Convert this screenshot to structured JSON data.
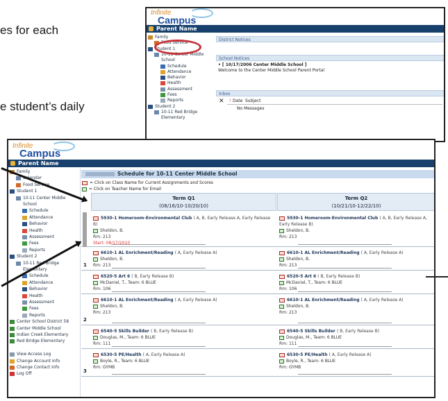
{
  "document": {
    "line1": "es for each",
    "line2": "e student’s daily"
  },
  "back": {
    "logo_top": "Infinite",
    "logo_bottom": "Campus",
    "bar_title": "Parent Name",
    "sidebar": [
      {
        "label": "Family",
        "icon": "family-icon"
      },
      {
        "label": "Food Service",
        "icon": "food-icon"
      },
      {
        "label": "Student 1",
        "icon": "student-icon"
      },
      {
        "label": "10-11 Center Middle",
        "icon": "calendar-icon"
      },
      {
        "label": "School",
        "icon": ""
      },
      {
        "label": "Schedule",
        "icon": "schedule-icon"
      },
      {
        "label": "Attendance",
        "icon": "attendance-icon"
      },
      {
        "label": "Behavior",
        "icon": "behavior-icon"
      },
      {
        "label": "Health",
        "icon": "health-icon"
      },
      {
        "label": "Assessment",
        "icon": "assessment-icon"
      },
      {
        "label": "Fees",
        "icon": "fees-icon"
      },
      {
        "label": "Reports",
        "icon": "reports-icon"
      },
      {
        "label": "Student 2",
        "icon": "student-icon"
      },
      {
        "label": "10-11 Red Bridge",
        "icon": "calendar-icon"
      },
      {
        "label": "Elementary",
        "icon": ""
      }
    ],
    "district_notices": "District Notices",
    "school_notices": "School Notices",
    "notice_line1": "• [ 10/17/2006 Center Middle School ]",
    "notice_line2": "Welcome to the Center Middle School Parent Portal",
    "inbox": "Inbox",
    "inbox_cols": [
      "Date",
      "Subject"
    ],
    "no_messages": "No Messages"
  },
  "front": {
    "logo_top": "Infinite",
    "logo_bottom": "Campus",
    "bar_title": "Parent Name",
    "sidebar": [
      {
        "label": "Family",
        "icon": "family-icon",
        "indent": 0
      },
      {
        "label": "Calendar",
        "icon": "calendar-icon",
        "indent": 1
      },
      {
        "label": "Food Service",
        "icon": "food-icon",
        "indent": 1
      },
      {
        "label": "Student 1",
        "icon": "student-icon",
        "indent": 0
      },
      {
        "label": "10-11 Center Middle",
        "icon": "calendar-icon",
        "indent": 1
      },
      {
        "label": "School",
        "icon": "",
        "indent": 1
      },
      {
        "label": "Schedule",
        "icon": "schedule-icon",
        "indent": 2
      },
      {
        "label": "Attendance",
        "icon": "attendance-icon",
        "indent": 2
      },
      {
        "label": "Behavior",
        "icon": "behavior-icon",
        "indent": 2
      },
      {
        "label": "Health",
        "icon": "health-icon",
        "indent": 2
      },
      {
        "label": "Assessment",
        "icon": "assessment-icon",
        "indent": 2
      },
      {
        "label": "Fees",
        "icon": "fees-icon",
        "indent": 2
      },
      {
        "label": "Reports",
        "icon": "reports-icon",
        "indent": 2
      },
      {
        "label": "Student 2",
        "icon": "student-icon",
        "indent": 0
      },
      {
        "label": "10-11 Red Bridge",
        "icon": "calendar-icon",
        "indent": 1
      },
      {
        "label": "Elementary",
        "icon": "",
        "indent": 1
      },
      {
        "label": "Schedule",
        "icon": "schedule-icon",
        "indent": 2
      },
      {
        "label": "Attendance",
        "icon": "attendance-icon",
        "indent": 2
      },
      {
        "label": "Behavior",
        "icon": "behavior-icon",
        "indent": 2
      },
      {
        "label": "Health",
        "icon": "health-icon",
        "indent": 2
      },
      {
        "label": "Assessment",
        "icon": "assessment-icon",
        "indent": 2
      },
      {
        "label": "Fees",
        "icon": "fees-icon",
        "indent": 2
      },
      {
        "label": "Reports",
        "icon": "reports-icon",
        "indent": 2
      },
      {
        "label": "Center School District 58",
        "icon": "link-icon",
        "indent": 0
      },
      {
        "label": "Center Middle School",
        "icon": "link-icon",
        "indent": 0
      },
      {
        "label": "Indian Creek Elementary",
        "icon": "link-icon",
        "indent": 0
      },
      {
        "label": "Red Bridge Elementary",
        "icon": "link-icon",
        "indent": 0
      },
      {
        "label": "",
        "icon": "",
        "indent": 0
      },
      {
        "label": "View Access Log",
        "icon": "log-icon",
        "indent": 0
      },
      {
        "label": "Change Account Info",
        "icon": "account-icon",
        "indent": 0
      },
      {
        "label": "Change Contact Info",
        "icon": "contact-icon",
        "indent": 0
      },
      {
        "label": "Log Off",
        "icon": "logoff-icon",
        "indent": 0
      }
    ],
    "schedule_title": "Schedule for 10-11 Center Middle School",
    "hint1": "= Click on Class Name for Current Assignments and Scores",
    "hint2": "= Click on Teacher Name for Email",
    "terms": [
      {
        "name": "Term Q1",
        "dates": "(08/16/10-10/20/10)"
      },
      {
        "name": "Term Q2",
        "dates": "(10/21/10-12/22/10)"
      }
    ],
    "periods": [
      "",
      "1",
      "",
      "2",
      "",
      "3"
    ],
    "rows": [
      [
        {
          "cls": "5930-1 Homeroom-Environmental Club",
          "tags": "( A, B, Early Release A, Early Release B)",
          "teacher": "Sheldon, B.",
          "room": "Rm: 213",
          "extra": "Start: 08/17/2010"
        },
        {
          "cls": "5930-1 Homeroom-Environmental Club",
          "tags": "( A, B, Early Release A, Early Release B)",
          "teacher": "Sheldon, B.",
          "room": "Rm: 213",
          "extra": ""
        }
      ],
      [
        {
          "cls": "6610-1 AL Enrichment/Reading",
          "tags": "( A, Early Release A)",
          "teacher": "Sheldon, B.",
          "room": "Rm: 213",
          "extra": ""
        },
        {
          "cls": "6610-1 AL Enrichment/Reading",
          "tags": "( A, Early Release A)",
          "teacher": "Sheldon, B.",
          "room": "Rm: 213",
          "extra": ""
        }
      ],
      [
        {
          "cls": "6520-5 Art 6",
          "tags": "( B, Early Release B)",
          "teacher": "McDaniel, T., Team: 6 BLUE",
          "room": "Rm: 106",
          "extra": ""
        },
        {
          "cls": "6520-5 Art 6",
          "tags": "( B, Early Release B)",
          "teacher": "McDaniel, T., Team: 6 BLUE",
          "room": "Rm: 106",
          "extra": ""
        }
      ],
      [
        {
          "cls": "6610-1 AL Enrichment/Reading",
          "tags": "( A, Early Release A)",
          "teacher": "Sheldon, B.",
          "room": "Rm: 213",
          "extra": ""
        },
        {
          "cls": "6610-1 AL Enrichment/Reading",
          "tags": "( A, Early Release A)",
          "teacher": "Sheldon, B.",
          "room": "Rm: 213",
          "extra": ""
        }
      ],
      [
        {
          "cls": "6540-5 Skills Builder",
          "tags": "( B, Early Release B)",
          "teacher": "Douglas, M., Team: 6 BLUE",
          "room": "Rm: 111",
          "extra": ""
        },
        {
          "cls": "6540-5 Skills Builder",
          "tags": "( B, Early Release B)",
          "teacher": "Douglas, M., Team: 6 BLUE",
          "room": "Rm: 111",
          "extra": ""
        }
      ],
      [
        {
          "cls": "6530-5 PE/Health",
          "tags": "( A, Early Release A)",
          "teacher": "Boyle, R., Team: 6 BLUE",
          "room": "Rm: GYMB",
          "extra": ""
        },
        {
          "cls": "6530-5 PE/Health",
          "tags": "( A, Early Release A)",
          "teacher": "Boyle, R., Team: 6 BLUE",
          "room": "Rm: GYMB",
          "extra": ""
        }
      ]
    ]
  },
  "colors": {
    "header_bar": "#17406d",
    "circle": "#c6333a",
    "accent": "#d78a2e"
  }
}
